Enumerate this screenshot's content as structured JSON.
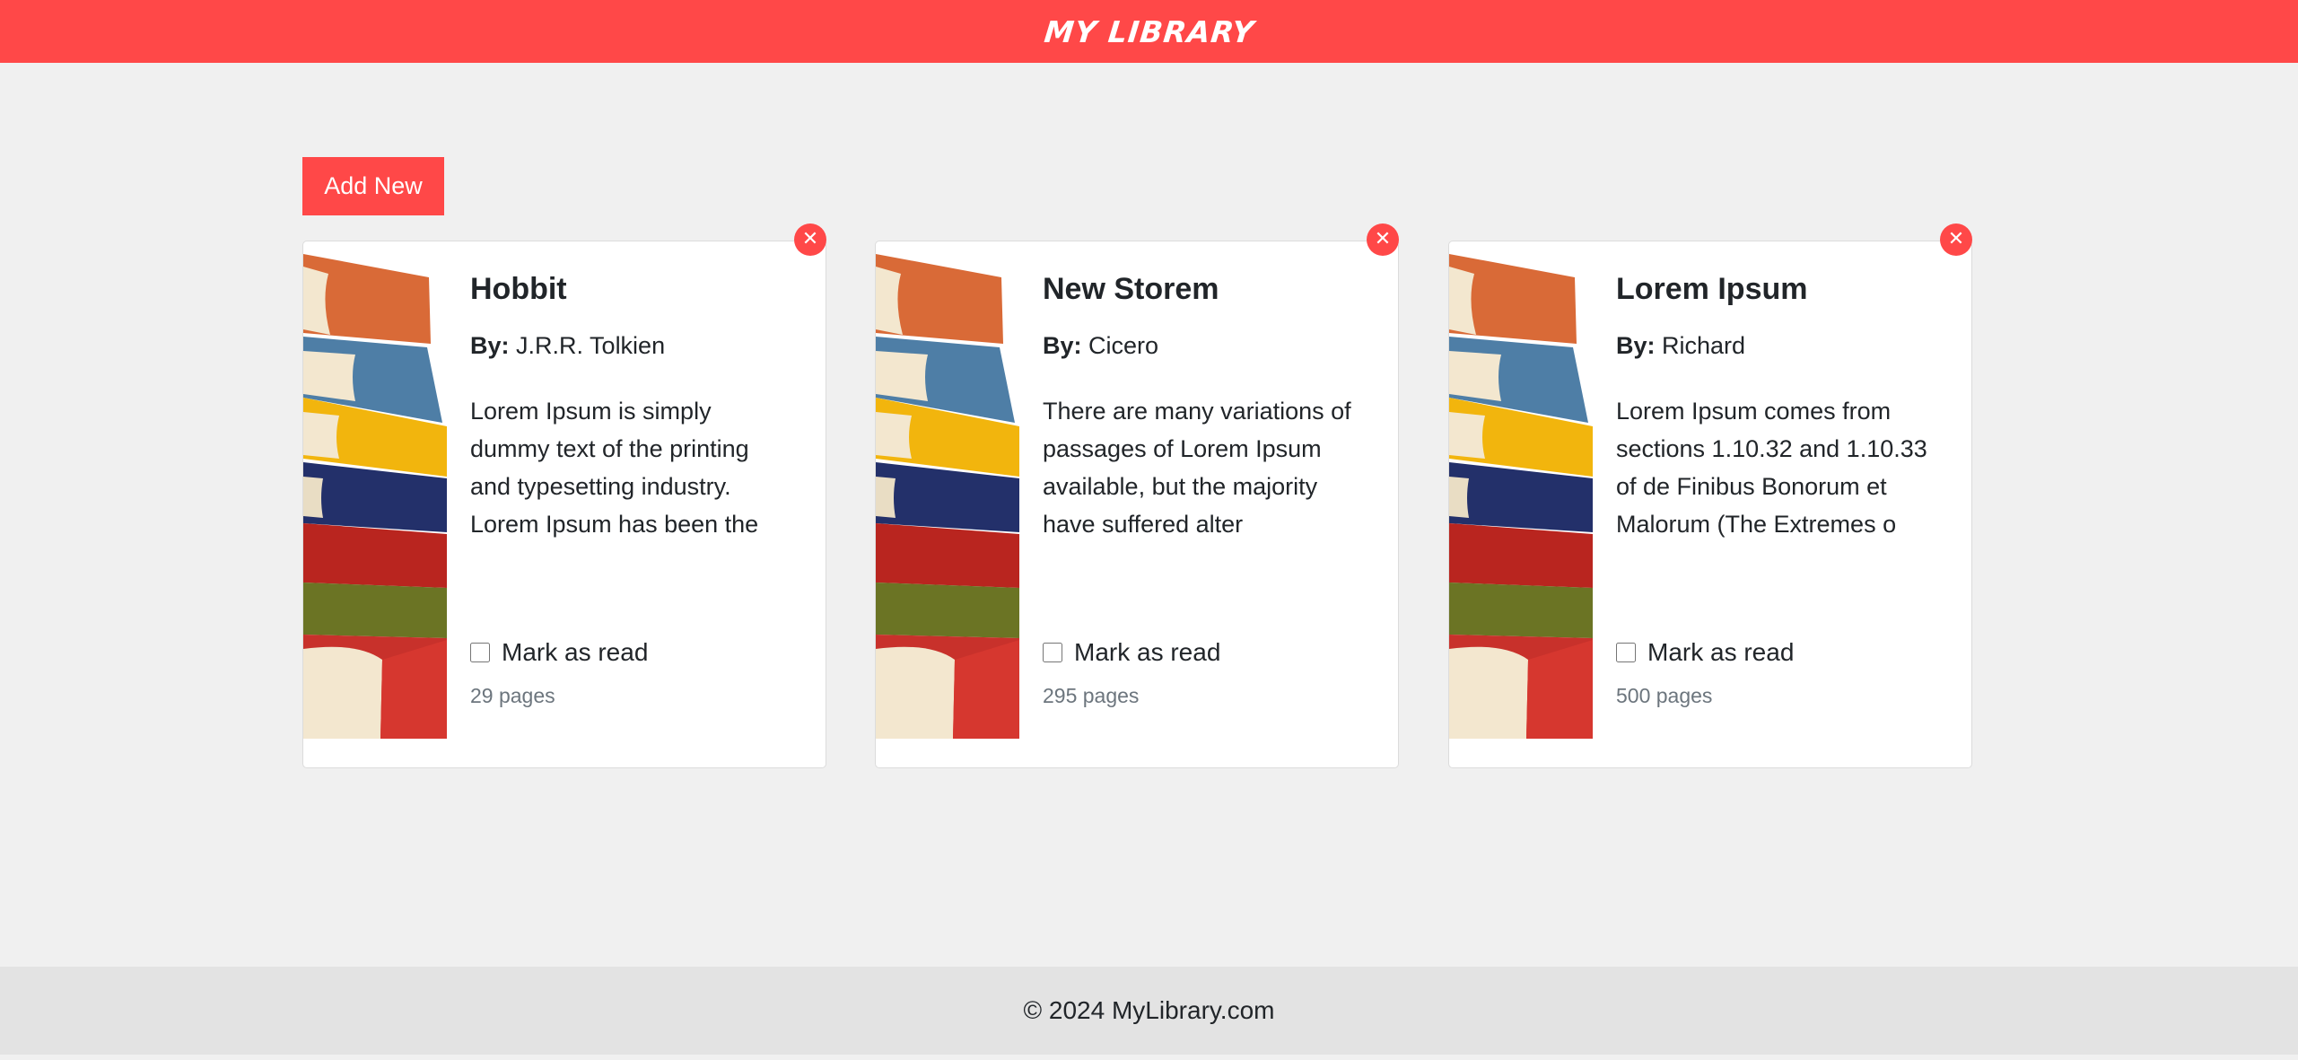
{
  "header": {
    "brand": "MY LIBRARY"
  },
  "toolbar": {
    "add_label": "Add New"
  },
  "books": [
    {
      "title": "Hobbit",
      "by_label": "By:",
      "author": "J.R.R. Tolkien",
      "description": "Lorem Ipsum is simply dummy text of the printing and typesetting industry. Lorem Ipsum has been the",
      "read_label": "Mark as read",
      "read": false,
      "pages": "29 pages",
      "close_glyph": "✕"
    },
    {
      "title": "New Storem",
      "by_label": "By:",
      "author": "Cicero",
      "description": "There are many variations of passages of Lorem Ipsum available, but the majority have suffered alter",
      "read_label": "Mark as read",
      "read": false,
      "pages": "295 pages",
      "close_glyph": "✕"
    },
    {
      "title": "Lorem Ipsum",
      "by_label": "By:",
      "author": "Richard",
      "description": "Lorem Ipsum comes from sections 1.10.32 and 1.10.33 of de Finibus Bonorum et Malorum (The Extremes o",
      "read_label": "Mark as read",
      "read": false,
      "pages": "500 pages",
      "close_glyph": "✕"
    }
  ],
  "footer": {
    "text": "© 2024 MyLibrary.com"
  },
  "colors": {
    "accent": "#ff4848",
    "background": "#f0f0f0",
    "footer_bg": "#e3e3e3",
    "muted_text": "#6c757d"
  },
  "icons": {
    "close": "close-icon",
    "cover": "book-stack-image"
  }
}
